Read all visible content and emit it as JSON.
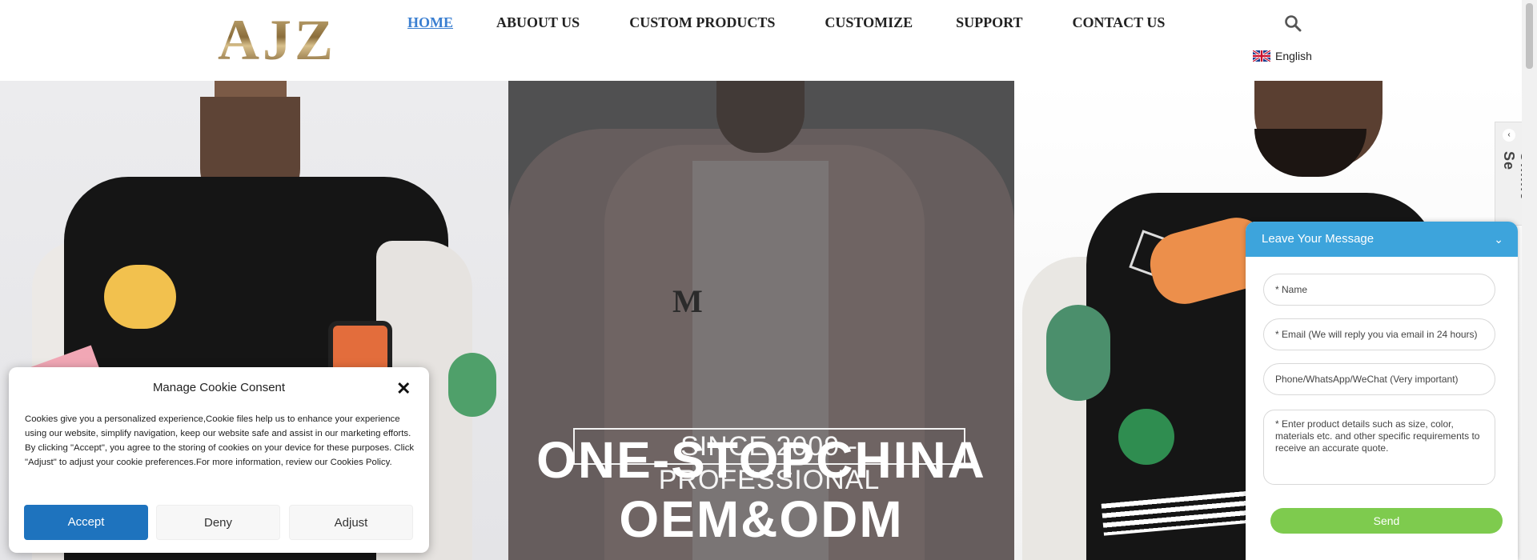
{
  "brand": {
    "logo_text": "AJZ"
  },
  "nav": {
    "items": [
      {
        "label": "HOME",
        "active": true,
        "has_dropdown": false
      },
      {
        "label": "ABUOUT US",
        "active": false,
        "has_dropdown": true
      },
      {
        "label": "CUSTOM PRODUCTS",
        "active": false,
        "has_dropdown": true
      },
      {
        "label": "CUSTOMIZE",
        "active": false,
        "has_dropdown": false
      },
      {
        "label": "SUPPORT",
        "active": false,
        "has_dropdown": true
      },
      {
        "label": "CONTACT US",
        "active": false,
        "has_dropdown": false
      }
    ],
    "dropdown_glyph": "",
    "search_icon": "search-icon"
  },
  "language": {
    "label": "English",
    "flag_icon": "uk-flag-icon",
    "caret": ""
  },
  "hero": {
    "since_text": "SINCE 2009 -PROFESSIONAL",
    "headline_line1": "ONE-STOPCHINA",
    "headline_line2": "OEM&ODM"
  },
  "side_tab": {
    "label": "Online Se"
  },
  "message_widget": {
    "title": "Leave Your Message",
    "name_placeholder": "* Name",
    "email_placeholder": "* Email (We will reply you via email in 24 hours)",
    "phone_placeholder": "Phone/WhatsApp/WeChat (Very important)",
    "details_placeholder": "* Enter product details such as size, color, materials etc. and other specific requirements to receive an accurate quote.",
    "send_label": "Send"
  },
  "cookie": {
    "title": "Manage Cookie Consent",
    "body": "Cookies give you a personalized experience,Cookie files help us to enhance your experience using our website, simplify navigation, keep our website safe and assist in our marketing efforts. By clicking \"Accept\", you agree to the storing of cookies on your device for these purposes. Click \"Adjust\" to adjust your cookie preferences.For more information, review our Cookies Policy.",
    "accept_label": "Accept",
    "deny_label": "Deny",
    "adjust_label": "Adjust"
  },
  "colors": {
    "accent_blue": "#3b7fd1",
    "widget_header": "#3da4dc",
    "send_green": "#7ecb4e",
    "accept_blue": "#1e73be"
  }
}
